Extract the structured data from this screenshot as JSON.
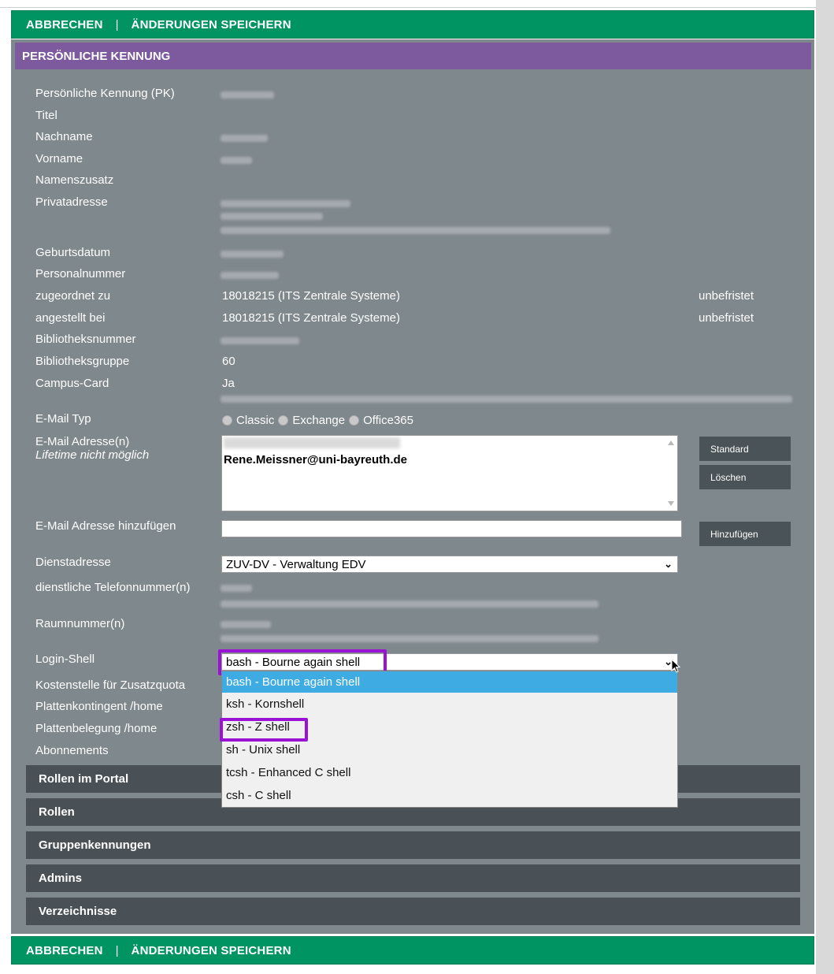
{
  "actions": {
    "cancel": "ABBRECHEN",
    "separator": "|",
    "save": "ÄNDERUNGEN SPEICHERN"
  },
  "section": {
    "title": "PERSÖNLICHE KENNUNG"
  },
  "labels": {
    "pk": "Persönliche Kennung (PK)",
    "titel": "Titel",
    "nachname": "Nachname",
    "vorname": "Vorname",
    "namenszusatz": "Namenszusatz",
    "privatadresse": "Privatadresse",
    "geburtsdatum": "Geburtsdatum",
    "personalnummer": "Personalnummer",
    "zugeordnet": "zugeordnet zu",
    "angestellt": "angestellt bei",
    "bibnummer": "Bibliotheksnummer",
    "bibgruppe": "Bibliotheksgruppe",
    "campuscard": "Campus-Card",
    "emailtyp": "E-Mail Typ",
    "emailadressen": "E-Mail Adresse(n)",
    "lifetime": "Lifetime nicht möglich",
    "emailhinzu": "E-Mail Adresse hinzufügen",
    "dienstadresse": "Dienstadresse",
    "telefon": "dienstliche Telefonnummer(n)",
    "raum": "Raumnummer(n)",
    "loginshell": "Login-Shell",
    "kostenstelle": "Kostenstelle für Zusatzquota",
    "plattenkontingent": "Plattenkontingent /home",
    "plattenbelegung": "Plattenbelegung /home",
    "abonnements": "Abonnements"
  },
  "values": {
    "zugeordnet": "18018215 (ITS Zentrale Systeme)",
    "zugeordnet_status": "unbefristet",
    "angestellt": "18018215 (ITS Zentrale Systeme)",
    "angestellt_status": "unbefristet",
    "bibgruppe": "60",
    "campuscard": "Ja",
    "email": "Rene.Meissner@uni-bayreuth.de",
    "dienstadresse": "ZUV-DV - Verwaltung EDV",
    "loginshell": "bash - Bourne again shell"
  },
  "email_types": [
    "Classic",
    "Exchange",
    "Office365"
  ],
  "buttons": {
    "standard": "Standard",
    "loeschen": "Löschen",
    "hinzufuegen": "Hinzufügen"
  },
  "shell_options": [
    "bash - Bourne again shell",
    "ksh - Kornshell",
    "zsh - Z shell",
    "sh - Unix shell",
    "tcsh - Enhanced C shell",
    "csh - C shell"
  ],
  "accordion": [
    "Rollen im Portal",
    "Rollen",
    "Gruppenkennungen",
    "Admins",
    "Verzeichnisse"
  ],
  "colors": {
    "action_bar": "#009463",
    "section_header": "#7c5a9d",
    "panel": "#7f888d",
    "accordion": "#495156",
    "highlight": "#9a13d4",
    "dropdown_selected": "#3eace2"
  }
}
